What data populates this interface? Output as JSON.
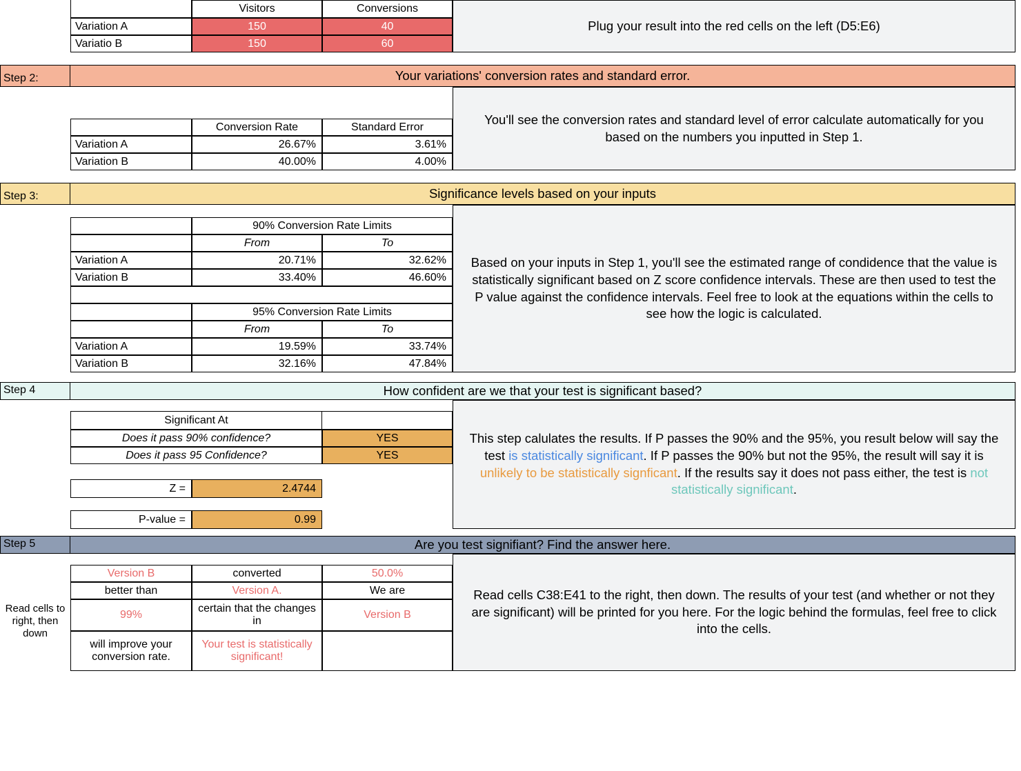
{
  "step1": {
    "headers": {
      "visitors": "Visitors",
      "conversions": "Conversions"
    },
    "rowA_label": "Variation A",
    "rowB_label": "Variatio B",
    "A_visitors": "150",
    "A_conversions": "40",
    "B_visitors": "150",
    "B_conversions": "60",
    "right_text": "Plug your result into the red cells on the left (D5:E6)"
  },
  "step2": {
    "label": "Step 2:",
    "title": "Your variations' conversion rates and standard error.",
    "headers": {
      "rate": "Conversion Rate",
      "stderr": "Standard Error"
    },
    "rowA": {
      "label": "Variation A",
      "rate": "26.67%",
      "stderr": "3.61%"
    },
    "rowB": {
      "label": "Variation B",
      "rate": "40.00%",
      "stderr": "4.00%"
    },
    "right_text": "You'll see the conversion rates and standard level of error calculate automatically for you based on the numbers you inputted in Step 1."
  },
  "step3": {
    "label": "Step 3:",
    "title": "Significance levels based on your inputs",
    "block90_title": "90% Conversion Rate Limits",
    "block95_title": "95% Conversion Rate Limits",
    "from": "From",
    "to": "To",
    "A_label": "Variation A",
    "B_label": "Variation B",
    "r90": {
      "A_from": "20.71%",
      "A_to": "32.62%",
      "B_from": "33.40%",
      "B_to": "46.60%"
    },
    "r95": {
      "A_from": "19.59%",
      "A_to": "33.74%",
      "B_from": "32.16%",
      "B_to": "47.84%"
    },
    "right_text": "Based on your inputs in Step 1, you'll see the estimated range of condidence that the value is statistically significant based on Z score confidence intervals. These are then used to test the P value against the confidence intervals. Feel free to look at the equations within the cells to see how the logic is calculated."
  },
  "step4": {
    "label": "Step 4",
    "title": "How confident are we that your test is significant based?",
    "sig_title": "Significant At",
    "q90": "Does it pass 90% confidence?",
    "q95": "Does it pass 95 Confidence?",
    "ans90": "YES",
    "ans95": "YES",
    "z_label": "Z =",
    "z_value": "2.4744",
    "p_label": "P-value =",
    "p_value": "0.99",
    "right": {
      "pre": "This step calulates the results. If P passes the 90% and the 95%, you result below will say the test ",
      "sig": "is statistically significant",
      "mid1": ". If P passes the 90% but not the 95%, the result will say it is ",
      "unlikely": "unlikely to be statistically signficant",
      "mid2": ". If the results say it does not pass either, the test is ",
      "notsig": "not statistically significant",
      "end": "."
    }
  },
  "step5": {
    "label": "Step 5",
    "title": "Are you test signifiant? Find the answer here.",
    "side_label": "Read cells to right, then down",
    "grid": {
      "r1": {
        "c1": "Version B",
        "c2": "converted",
        "c3": "50.0%"
      },
      "r2": {
        "c1": "better than",
        "c2": "Version A.",
        "c3": "We are"
      },
      "r3": {
        "c1": "99%",
        "c2": "certain that the changes in",
        "c3": "Version B"
      },
      "r4": {
        "c1": "will improve your conversion rate.",
        "c2": "Your test is statistically significant!",
        "c3": ""
      }
    },
    "right_text": "Read cells C38:E41 to the right, then down. The results of your test (and whether or not they are significant) will be printed for you here. For the logic behind the formulas, feel free to click into the cells."
  }
}
